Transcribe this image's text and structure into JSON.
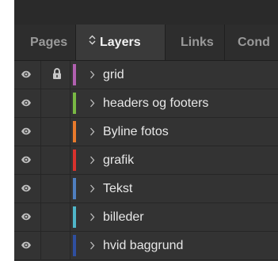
{
  "tabs": [
    {
      "label": "Pages"
    },
    {
      "label": "Layers"
    },
    {
      "label": "Links"
    },
    {
      "label": "Cond"
    }
  ],
  "icons": {
    "visibility": "eye-icon",
    "lock": "lock-icon",
    "expand": "chevron-right-icon",
    "tab_menu": "chevron-updown-icon"
  },
  "layers": [
    {
      "name": "grid",
      "color": "#b160b0",
      "locked": true
    },
    {
      "name": "headers og footers",
      "color": "#79b944",
      "locked": false
    },
    {
      "name": "Byline fotos",
      "color": "#e87a2c",
      "locked": false
    },
    {
      "name": "grafik",
      "color": "#d9322d",
      "locked": false
    },
    {
      "name": "Tekst",
      "color": "#4f7fc0",
      "locked": false
    },
    {
      "name": "billeder",
      "color": "#4fb6c9",
      "locked": false
    },
    {
      "name": "hvid baggrund",
      "color": "#2f4fa0",
      "locked": false
    }
  ]
}
